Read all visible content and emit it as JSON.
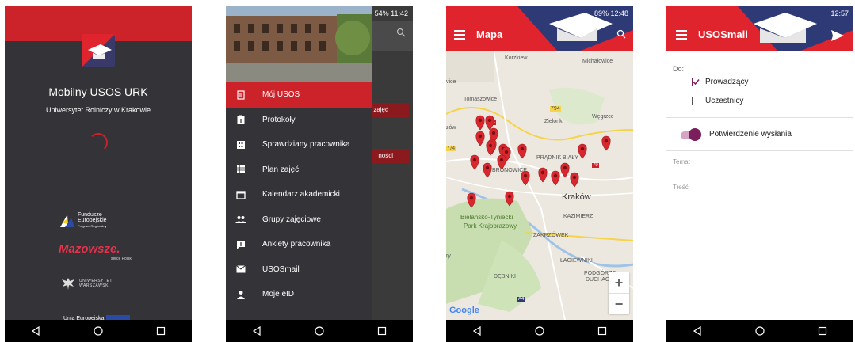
{
  "screen1": {
    "title": "Mobilny USOS URK",
    "subtitle": "Uniwersytet Rolniczy w Krakowie",
    "funds_line1": "Fundusze",
    "funds_line2": "Europejskie",
    "funds_line3": "Program Regionalny",
    "mazowsze": "Mazowsze.",
    "mazowsze_sub": "serce Polski",
    "uw_line1": "UNIWERSYTET",
    "uw_line2": "WARSZAWSKI",
    "ue_text": "Unia Europejska"
  },
  "screen2": {
    "status": "54% 11:42",
    "behind_btn1": "zajęć",
    "behind_btn2": "ności",
    "menu": [
      {
        "label": "Mój USOS",
        "icon": "document-icon"
      },
      {
        "label": "Protokoły",
        "icon": "clipboard-icon"
      },
      {
        "label": "Sprawdziany pracownika",
        "icon": "test-card-icon"
      },
      {
        "label": "Plan zajęć",
        "icon": "calendar-grid-icon"
      },
      {
        "label": "Kalendarz akademicki",
        "icon": "calendar-icon"
      },
      {
        "label": "Grupy zajęciowe",
        "icon": "group-icon"
      },
      {
        "label": "Ankiety pracownika",
        "icon": "survey-icon"
      },
      {
        "label": "USOSmail",
        "icon": "mail-icon"
      },
      {
        "label": "Moje eID",
        "icon": "person-icon"
      }
    ]
  },
  "screen3": {
    "status": "89% 12:48",
    "title": "Mapa",
    "labels": {
      "korzkiew": "Korzkiew",
      "michalowice": "Michałowice",
      "tomaszowice": "Tomaszowice",
      "zielonki": "Zielonki",
      "wegrzce": "Węgrzce",
      "pradnik": "PRĄDNIK BIAŁY",
      "bronowice": "BRONOWICE",
      "krakow": "Kraków",
      "kazimierz": "KAZIMIERZ",
      "zakrzowek": "ZAKRZÓWEK",
      "bielany": "Bielańsko-Tyniecki",
      "park": "Park Krajobrazowy",
      "lagiewniki": "ŁAGIEWNIKI",
      "debniki": "DĘBNIKI",
      "podgorze": "PODGÓRZE",
      "duchacki": "DUCHACKI",
      "r794": "794",
      "r79": "79",
      "r94": "94",
      "r774": "774",
      "a4": "A4",
      "zow": "zów",
      "vice": "vice",
      "ry": "ry",
      "google": "Google",
      "zoom_in": "+",
      "zoom_out": "−"
    }
  },
  "screen4": {
    "status": "12:57",
    "title": "USOSmail",
    "do_label": "Do:",
    "checkbox1": "Prowadzący",
    "checkbox2": "Uczestnicy",
    "toggle_label": "Potwierdzenie wysłania",
    "temat": "Temat",
    "tresc": "Treść"
  },
  "colors": {
    "brand_red": "#cc2229",
    "dark": "#333338",
    "accent_purple": "#7b1e5c"
  }
}
